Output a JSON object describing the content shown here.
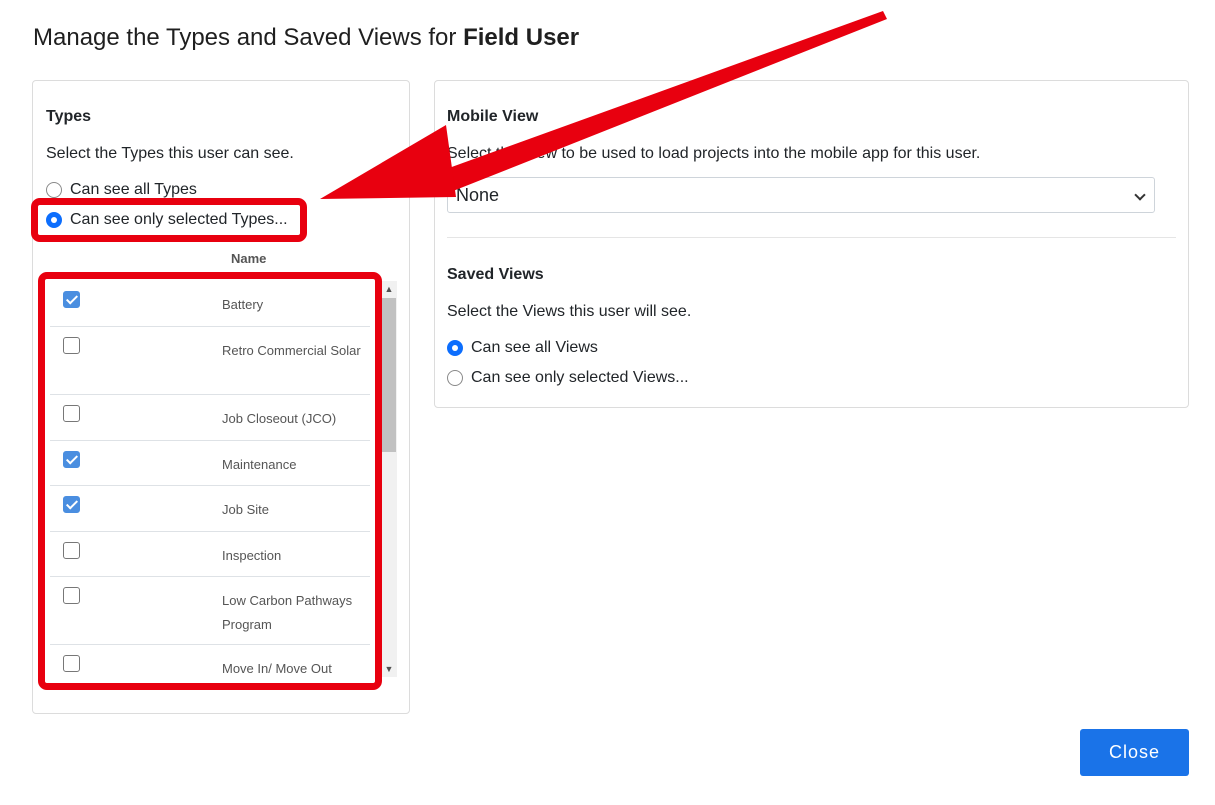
{
  "dialog": {
    "title_prefix": "Manage the Types and Saved Views for",
    "title_user": "Field User"
  },
  "types": {
    "heading": "Types",
    "description": "Select the Types this user can see.",
    "radio_all": "Can see all Types",
    "radio_selected": "Can see only selected Types...",
    "selected_option": "selected",
    "column_header": "Name",
    "items": [
      {
        "label": "Battery",
        "checked": true
      },
      {
        "label": "Retro Commercial Solar",
        "checked": false
      },
      {
        "label": "Job Closeout (JCO)",
        "checked": false
      },
      {
        "label": "Maintenance",
        "checked": true
      },
      {
        "label": "Job Site",
        "checked": true
      },
      {
        "label": "Inspection",
        "checked": false
      },
      {
        "label": "Low Carbon Pathways Program",
        "checked": false
      },
      {
        "label": "Move In/ Move Out",
        "checked": false
      }
    ]
  },
  "mobile_view": {
    "heading": "Mobile View",
    "description": "Select the View to be used to load projects into the mobile app for this user.",
    "selected_value": "None"
  },
  "saved_views": {
    "heading": "Saved Views",
    "description": "Select the Views this user will see.",
    "radio_all": "Can see all Views",
    "radio_selected": "Can see only selected Views...",
    "selected_option": "all"
  },
  "footer": {
    "close_label": "Close"
  },
  "colors": {
    "primary": "#1a73e8",
    "radio_checked": "#0d6efd",
    "checkbox_checked": "#4a8ee0",
    "annotation_red": "#e8000f"
  },
  "icons": {
    "select_caret": "chevron-down-icon",
    "scroll_up": "triangle-up-icon",
    "scroll_down": "triangle-down-icon",
    "annotation": "arrow-icon"
  }
}
